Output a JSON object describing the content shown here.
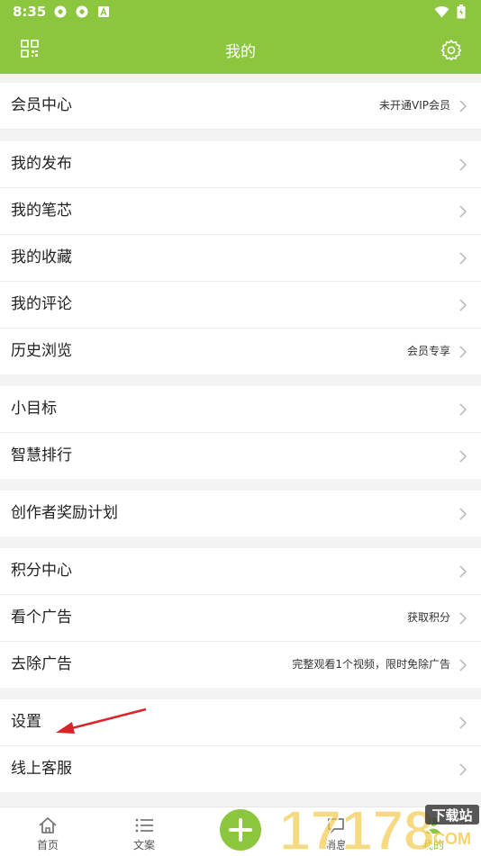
{
  "status_bar": {
    "time": "8:35"
  },
  "header": {
    "title": "我的"
  },
  "sections": [
    {
      "items": [
        {
          "label": "会员中心",
          "hint": "未开通VIP会员"
        }
      ]
    },
    {
      "items": [
        {
          "label": "我的发布",
          "hint": ""
        },
        {
          "label": "我的笔芯",
          "hint": ""
        },
        {
          "label": "我的收藏",
          "hint": ""
        },
        {
          "label": "我的评论",
          "hint": ""
        },
        {
          "label": "历史浏览",
          "hint": "会员专享"
        }
      ]
    },
    {
      "items": [
        {
          "label": "小目标",
          "hint": ""
        },
        {
          "label": "智慧排行",
          "hint": ""
        }
      ]
    },
    {
      "items": [
        {
          "label": "创作者奖励计划",
          "hint": ""
        }
      ]
    },
    {
      "items": [
        {
          "label": "积分中心",
          "hint": ""
        },
        {
          "label": "看个广告",
          "hint": "获取积分"
        },
        {
          "label": "去除广告",
          "hint": "完整观看1个视频，限时免除广告"
        }
      ]
    },
    {
      "items": [
        {
          "label": "设置",
          "hint": ""
        },
        {
          "label": "线上客服",
          "hint": ""
        }
      ]
    }
  ],
  "tabbar": {
    "home": "首页",
    "posts": "文案",
    "messages": "消息",
    "mine": "我的"
  },
  "watermark": {
    "text": "下载站",
    "number": "17178",
    "domain": ".COM"
  },
  "colors": {
    "brand": "#8cc63f",
    "annotation_arrow": "#d9252a"
  }
}
